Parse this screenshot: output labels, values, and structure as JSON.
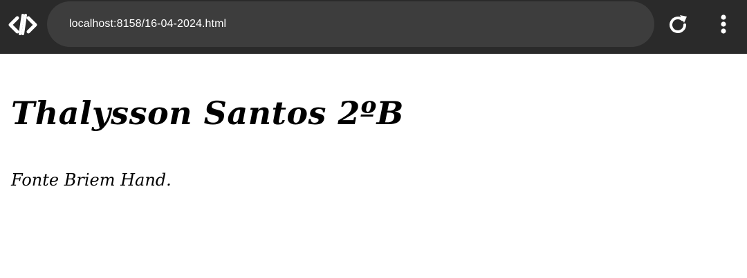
{
  "browser": {
    "url": "localhost:8158/16-04-2024.html",
    "logo_icon": "code-brackets-icon",
    "reload_icon": "reload-icon",
    "menu_icon": "kebab-menu-icon"
  },
  "page": {
    "heading": "Thalysson Santos 2ºB",
    "paragraph": "Fonte Briem Hand."
  }
}
